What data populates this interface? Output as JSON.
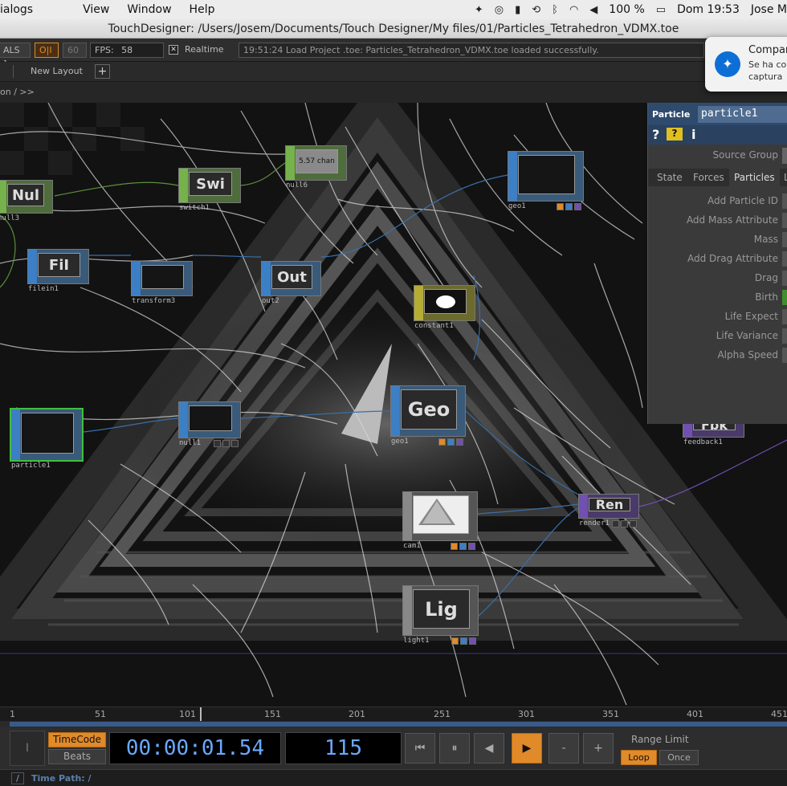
{
  "menubar": {
    "items": [
      "ialogs",
      "View",
      "Window",
      "Help"
    ],
    "battery": "100 %",
    "clock": "Dom 19:53",
    "user": "Jose M"
  },
  "window_title": "TouchDesigner: /Users/Josem/Documents/Touch Designer/My files/01/Particles_Tetrahedron_VDMX.toe",
  "toolbar": {
    "als": "ALS ]",
    "oi": "O|I",
    "fps_target": "60",
    "fps_label": "FPS:",
    "fps_value": "58",
    "realtime": "Realtime",
    "status": "19:51:24 Load Project .toe: Particles_Tetrahedron_VDMX.toe loaded successfully.",
    "new_layout": "New Layout",
    "add": "+",
    "path": "on / >>"
  },
  "notification": {
    "title": "Compar",
    "line1": "Se ha co",
    "line2": "captura"
  },
  "nodes": [
    {
      "id": "null3",
      "title": "Nul",
      "label": "null3"
    },
    {
      "id": "switch1",
      "title": "Swi",
      "label": "switch1"
    },
    {
      "id": "null6",
      "title": "5.57 chan",
      "label": "null6"
    },
    {
      "id": "file1",
      "title": "FiI",
      "label": "filein1"
    },
    {
      "id": "transform3",
      "title": "",
      "label": "transform3"
    },
    {
      "id": "out2",
      "title": "Out",
      "label": "out2"
    },
    {
      "id": "geo1",
      "title": "",
      "label": "geo1"
    },
    {
      "id": "constant1",
      "title": "",
      "label": "constant1"
    },
    {
      "id": "particle1",
      "title": "",
      "label": "particle1"
    },
    {
      "id": "null1",
      "title": "",
      "label": "null1"
    },
    {
      "id": "geo2",
      "title": "Geo",
      "label": "geo1"
    },
    {
      "id": "feedback1",
      "title": "Fbk",
      "label": "feedback1"
    },
    {
      "id": "cam1",
      "title": "",
      "label": "cam1"
    },
    {
      "id": "render1",
      "title": "Ren",
      "label": "render1"
    },
    {
      "id": "light1",
      "title": "Lig",
      "label": "light1"
    }
  ],
  "panel": {
    "type": "Particle",
    "name": "particle1",
    "source_group": "Source Group",
    "tabs": [
      "State",
      "Forces",
      "Particles",
      "L"
    ],
    "params": [
      "Add Particle ID",
      "Add Mass Attribute",
      "Mass",
      "Add Drag Attribute",
      "Drag",
      "Birth",
      "Life Expect",
      "Life Variance",
      "Alpha Speed"
    ]
  },
  "ruler": [
    "1",
    "51",
    "101",
    "151",
    "201",
    "251",
    "301",
    "351",
    "401",
    "451"
  ],
  "transport": {
    "timecode": "TimeCode",
    "beats": "Beats",
    "time": "00:00:01.54",
    "frame": "115",
    "minus": "-",
    "plus": "+",
    "range_limit": "Range Limit",
    "loop": "Loop",
    "once": "Once"
  },
  "time_path": "Time Path: /",
  "colors": {
    "accent": "#e08a2a",
    "timecode": "#6aa9ff",
    "panel_header": "#2e4b6e"
  }
}
